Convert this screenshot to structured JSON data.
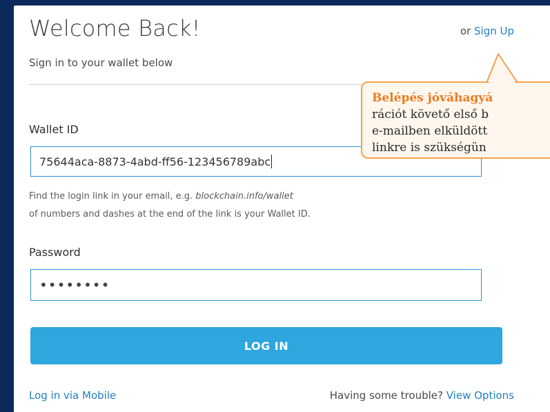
{
  "header": {
    "title": "Welcome Back!",
    "signup_prefix": "or",
    "signup_link": "Sign Up",
    "subtitle": "Sign in to your wallet below"
  },
  "wallet": {
    "label": "Wallet ID",
    "value": "75644aca-8873-4abd-ff56-123456789abc",
    "help_line1_prefix": "Find the login link in your email, e.g.",
    "help_line1_example": "blockchain.info/wallet",
    "help_line2": "of numbers and dashes at the end of the link is your Wallet ID."
  },
  "password": {
    "label": "Password",
    "masked_value": "••••••••"
  },
  "actions": {
    "login_label": "LOG IN",
    "mobile_link": "Log in via Mobile",
    "trouble_text": "Having some trouble?",
    "view_options_link": "View Options"
  },
  "callout": {
    "line1": "Belépés jóváhagyá",
    "line2": "rációt követő első b",
    "line3": "e-mailben elküldött",
    "line4": "linkre is szükségün"
  },
  "colors": {
    "page_background": "#0b2a5b",
    "accent": "#2fa6de",
    "link": "#1f7fc4",
    "callout_border": "#f5a04a",
    "callout_heading": "#ea7c1f"
  }
}
